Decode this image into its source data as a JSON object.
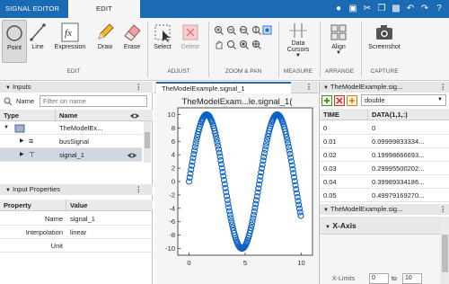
{
  "tabs": {
    "signal_editor": "SIGNAL EDITOR",
    "edit": "EDIT"
  },
  "ribbon": {
    "point": "Point",
    "line": "Line",
    "expression": "Expression",
    "draw": "Draw",
    "erase": "Erase",
    "select": "Select",
    "delete": "Delete",
    "data_cursors_1": "Data",
    "data_cursors_2": "Cursors",
    "align": "Align",
    "screenshot": "Screenshot",
    "sections": {
      "edit": "EDIT",
      "adjust": "ADJUST",
      "zoom_pan": "ZOOM & PAN",
      "measure": "MEASURE",
      "arrange": "ARRANGE",
      "capture": "CAPTURE"
    }
  },
  "inputs": {
    "title": "Inputs",
    "name_label": "Name",
    "filter_placeholder": "Filter on name",
    "col_type": "Type",
    "col_name": "Name",
    "rows": [
      {
        "name": "TheModelEx..."
      },
      {
        "name": "busSignal"
      },
      {
        "name": "signal_1"
      }
    ]
  },
  "props": {
    "title": "Input Properties",
    "col_property": "Property",
    "col_value": "Value",
    "rows": [
      {
        "property": "Name",
        "value": "signal_1"
      },
      {
        "property": "Interpolation",
        "value": "linear"
      },
      {
        "property": "Unit",
        "value": ""
      }
    ]
  },
  "plot": {
    "tab": "TheModelExample.signal_1",
    "title": "TheModelExam...le.signal_1(",
    "y_ticks": [
      "10",
      "8",
      "6",
      "4",
      "2",
      "0",
      "-2",
      "-4",
      "-6",
      "-8",
      "-10"
    ],
    "x_ticks": [
      "0",
      "5",
      "10"
    ]
  },
  "chart_data": {
    "type": "scatter",
    "title": "TheModelExam...le.signal_1(",
    "x_range": [
      0,
      10
    ],
    "y_range": [
      -10,
      10
    ],
    "xlim": [
      -1,
      11
    ],
    "ylim": [
      -11,
      11
    ],
    "x_step": 0.06,
    "function": "y = 10*sin(x)",
    "marker": "circle",
    "color": "#0d62c4"
  },
  "table": {
    "title": "TheModelExample.sig...",
    "type_value": "double",
    "col_time": "TIME",
    "col_data": "DATA(1,1,:)",
    "rows": [
      {
        "time": "0",
        "data": "0"
      },
      {
        "time": "0.01",
        "data": "0.09999833334..."
      },
      {
        "time": "0.02",
        "data": "0.19998666693..."
      },
      {
        "time": "0.03",
        "data": "0.29995500202..."
      },
      {
        "time": "0.04",
        "data": "0.39989334186..."
      },
      {
        "time": "0.05",
        "data": "0.49979169270..."
      }
    ]
  },
  "props2": {
    "title": "TheModelExample.sig...",
    "xaxis": "X-Axis",
    "xlimits": "X-Limits",
    "from": "0",
    "to_label": "to",
    "to": "10"
  }
}
